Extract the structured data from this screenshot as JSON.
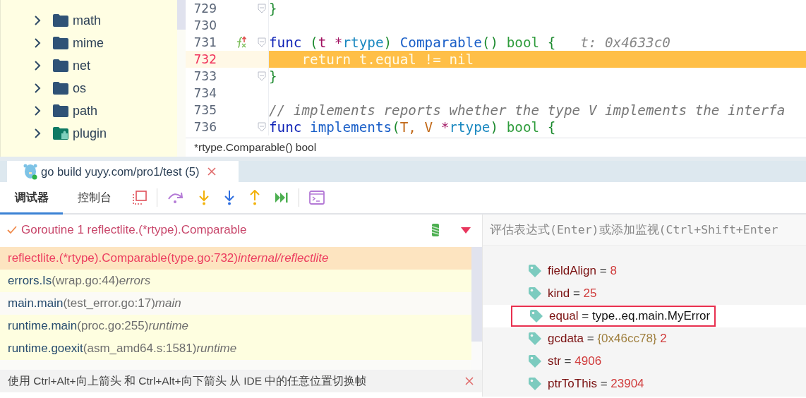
{
  "project_tree": {
    "items": [
      {
        "name": "math",
        "kind": "folder",
        "expanded": false
      },
      {
        "name": "mime",
        "kind": "folder",
        "expanded": false
      },
      {
        "name": "net",
        "kind": "folder",
        "expanded": false
      },
      {
        "name": "os",
        "kind": "folder",
        "expanded": false
      },
      {
        "name": "path",
        "kind": "folder",
        "expanded": false
      },
      {
        "name": "plugin",
        "kind": "plugin",
        "expanded": false
      }
    ]
  },
  "editor": {
    "lines": [
      {
        "number": "729",
        "fold": true,
        "marker": false,
        "execution_point": false,
        "tokens": [
          {
            "text": "}",
            "kind": "brace"
          }
        ]
      },
      {
        "number": "730",
        "fold": false,
        "marker": false,
        "execution_point": false
      },
      {
        "number": "731",
        "fold": true,
        "marker": true,
        "execution_point": false,
        "tokens": [
          {
            "text": "func ",
            "kind": "keyword"
          },
          {
            "text": "(",
            "kind": "brace"
          },
          {
            "text": "t *",
            "kind": "param"
          },
          {
            "text": "rtype",
            "kind": "type"
          },
          {
            "text": ") ",
            "kind": "brace"
          },
          {
            "text": "Comparable",
            "kind": "function"
          },
          {
            "text": "() ",
            "kind": "brace"
          },
          {
            "text": "bool ",
            "kind": "builtin"
          },
          {
            "text": "{",
            "kind": "brace"
          },
          {
            "text": "   t: 0x4633c0",
            "kind": "hint"
          }
        ]
      },
      {
        "number": "732",
        "fold": false,
        "marker": false,
        "execution_point": true,
        "tokens": [
          {
            "text": "    return t.equal != nil",
            "kind": "plain"
          }
        ]
      },
      {
        "number": "733",
        "fold": true,
        "marker": false,
        "execution_point": false,
        "tokens": [
          {
            "text": "}",
            "kind": "brace"
          }
        ]
      },
      {
        "number": "734",
        "fold": false,
        "marker": false,
        "execution_point": false
      },
      {
        "number": "735",
        "fold": false,
        "marker": false,
        "execution_point": false,
        "tokens": [
          {
            "text": "// implements reports whether the type V implements the interfa",
            "kind": "comment"
          }
        ]
      },
      {
        "number": "736",
        "fold": true,
        "marker": false,
        "execution_point": false,
        "tokens": [
          {
            "text": "func ",
            "kind": "keyword"
          },
          {
            "text": "implements",
            "kind": "function"
          },
          {
            "text": "(",
            "kind": "brace"
          },
          {
            "text": "T, V ",
            "kind": "typeparam"
          },
          {
            "text": "*",
            "kind": "param"
          },
          {
            "text": "rtype",
            "kind": "type"
          },
          {
            "text": ") ",
            "kind": "brace"
          },
          {
            "text": "bool ",
            "kind": "builtin"
          },
          {
            "text": "{",
            "kind": "brace"
          }
        ]
      }
    ],
    "breadcrumb": "*rtype.Comparable() bool"
  },
  "run_tab": {
    "title": "go build yuyy.com/pro1/test (5)"
  },
  "debug_tabs": [
    {
      "label": "调试器",
      "selected": true
    },
    {
      "label": "控制台",
      "selected": false
    }
  ],
  "goroutine": {
    "label": "Goroutine 1 reflectlite.(*rtype).Comparable"
  },
  "frames": [
    {
      "function": "reflectlite.(*rtype).Comparable",
      "location": "(type.go:732)",
      "package": "internal/reflectlite",
      "selected": true,
      "library": true
    },
    {
      "function": "errors.Is",
      "location": "(wrap.go:44)",
      "package": "errors",
      "selected": false,
      "library": true
    },
    {
      "function": "main.main",
      "location": "(test_error.go:17)",
      "package": "main",
      "selected": false,
      "library": false
    },
    {
      "function": "runtime.main",
      "location": "(proc.go:255)",
      "package": "runtime",
      "selected": false,
      "library": true
    },
    {
      "function": "runtime.goexit",
      "location": "(asm_amd64.s:1581)",
      "package": "runtime",
      "selected": false,
      "library": true
    }
  ],
  "hint": "使用 Ctrl+Alt+向上箭头 和 Ctrl+Alt+向下箭头 从 IDE 中的任意位置切换帧",
  "watch": {
    "placeholder": "评估表达式(Enter)或添加监视(Ctrl+Shift+Enter"
  },
  "variables": [
    {
      "name": "fieldAlign",
      "operator": "=",
      "value": "8",
      "kind": "number",
      "highlighted": false
    },
    {
      "name": "kind",
      "operator": "=",
      "value": "25",
      "kind": "number",
      "highlighted": false
    },
    {
      "name": "equal",
      "operator": "=",
      "value": "type..eq.main.MyError",
      "kind": "func",
      "highlighted": true
    },
    {
      "name": "gcdata",
      "operator": "=",
      "address": "{0x46cc78}",
      "value": "2",
      "kind": "pointer",
      "highlighted": false
    },
    {
      "name": "str",
      "operator": "=",
      "value": "4906",
      "kind": "number",
      "highlighted": false
    },
    {
      "name": "ptrToThis",
      "operator": "=",
      "value": "23904",
      "kind": "number",
      "highlighted": false
    }
  ]
}
